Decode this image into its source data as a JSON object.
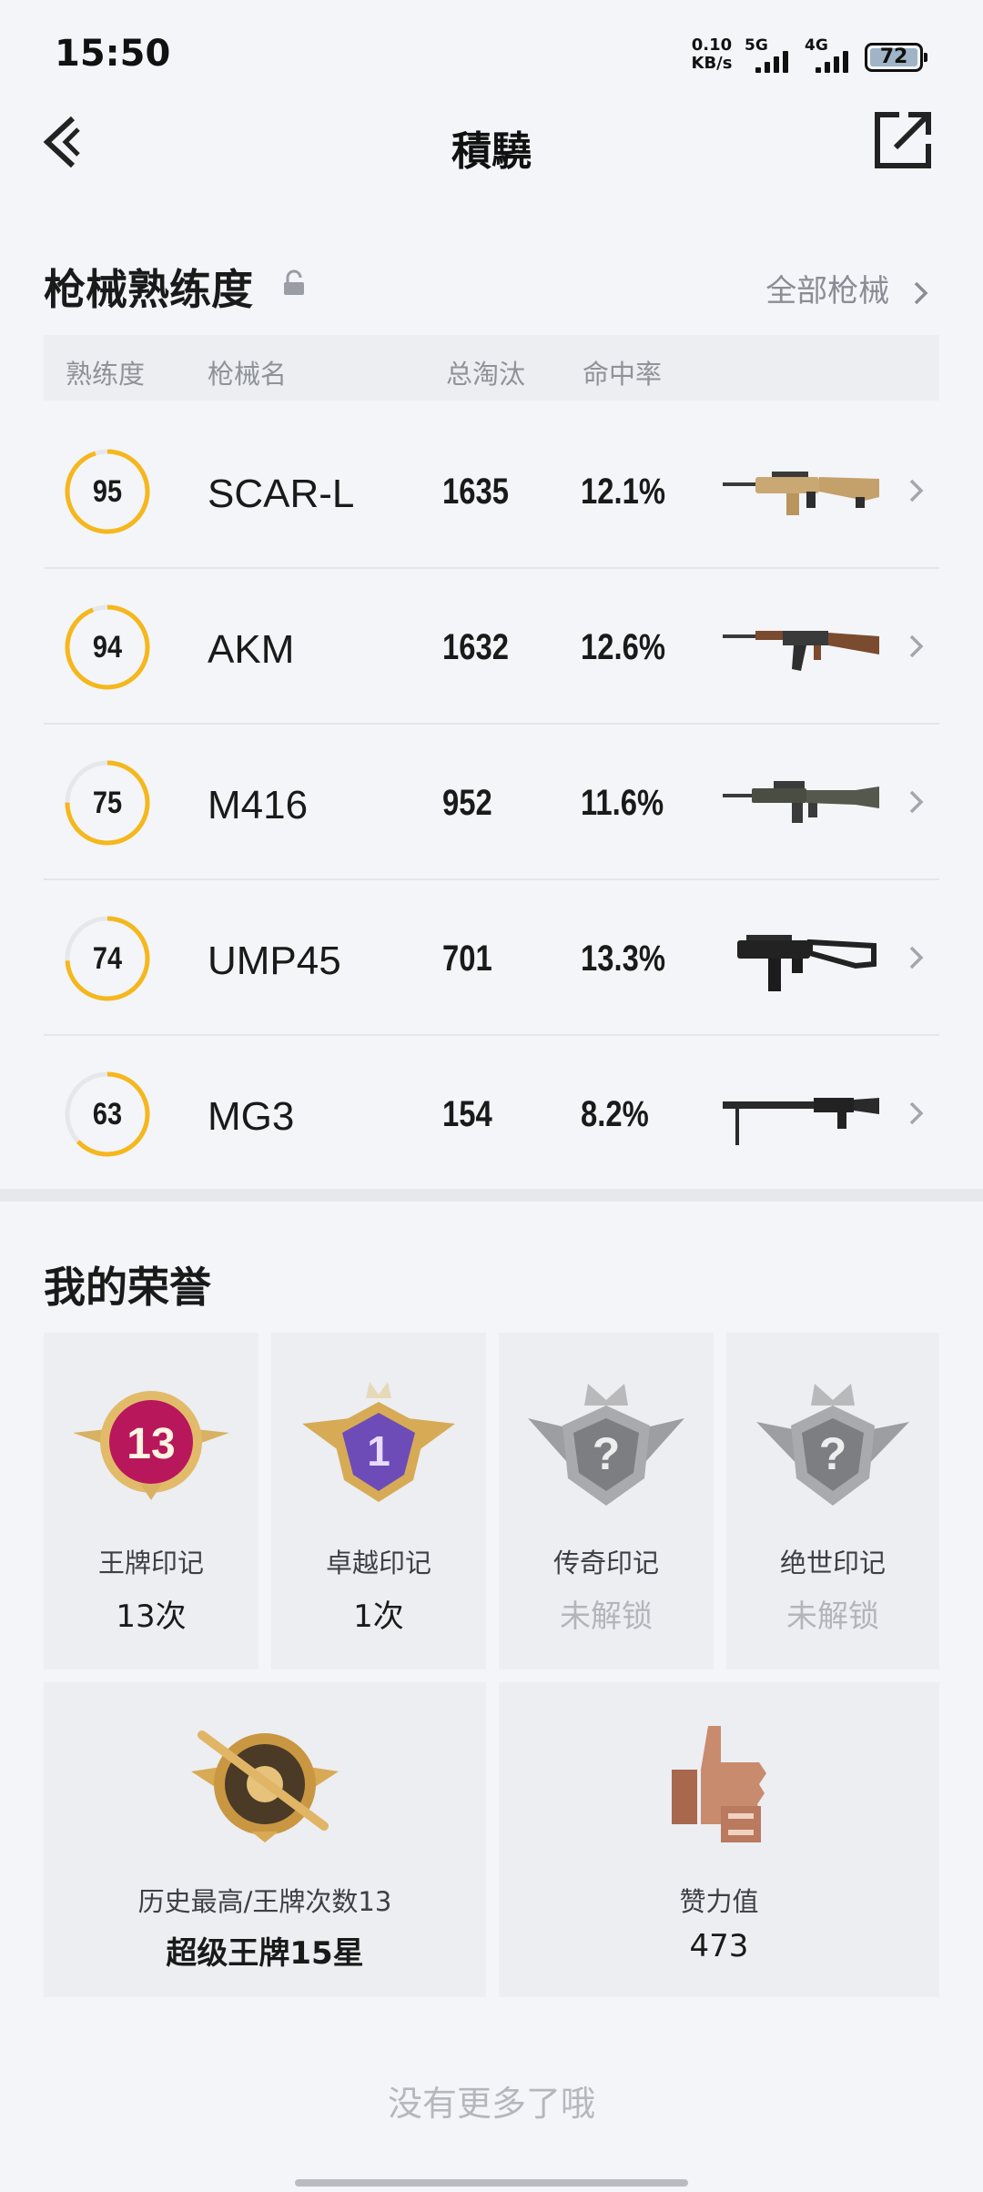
{
  "status_bar": {
    "time": "15:50",
    "net_speed_value": "0.10",
    "net_speed_unit": "KB/s",
    "signal_1_label": "5G",
    "signal_2_label": "4G",
    "battery": "72"
  },
  "nav": {
    "title": "積驍"
  },
  "weapons_section": {
    "title": "枪械熟练度",
    "all_link": "全部枪械",
    "columns": [
      "熟练度",
      "枪械名",
      "总淘汰",
      "命中率"
    ],
    "ring_color": "#f5b71c",
    "rows": [
      {
        "proficiency": "95",
        "name": "SCAR-L",
        "kills": "1635",
        "accuracy": "12.1%",
        "level": 0.95
      },
      {
        "proficiency": "94",
        "name": "AKM",
        "kills": "1632",
        "accuracy": "12.6%",
        "level": 0.94
      },
      {
        "proficiency": "75",
        "name": "M416",
        "kills": "952",
        "accuracy": "11.6%",
        "level": 0.75
      },
      {
        "proficiency": "74",
        "name": "UMP45",
        "kills": "701",
        "accuracy": "13.3%",
        "level": 0.74
      },
      {
        "proficiency": "63",
        "name": "MG3",
        "kills": "154",
        "accuracy": "8.2%",
        "level": 0.63
      }
    ]
  },
  "honor_section": {
    "title": "我的荣誉",
    "marks": [
      {
        "label": "王牌印记",
        "value": "13次",
        "badge": "13",
        "locked": false
      },
      {
        "label": "卓越印记",
        "value": "1次",
        "badge": "1",
        "locked": false
      },
      {
        "label": "传奇印记",
        "value": "未解锁",
        "badge": "?",
        "locked": true
      },
      {
        "label": "绝世印记",
        "value": "未解锁",
        "badge": "?",
        "locked": true
      }
    ],
    "history": {
      "label": "历史最高/王牌次数13",
      "value": "超级王牌15星"
    },
    "likes": {
      "label": "赞力值",
      "value": "473"
    }
  },
  "footer": {
    "no_more": "没有更多了哦"
  }
}
